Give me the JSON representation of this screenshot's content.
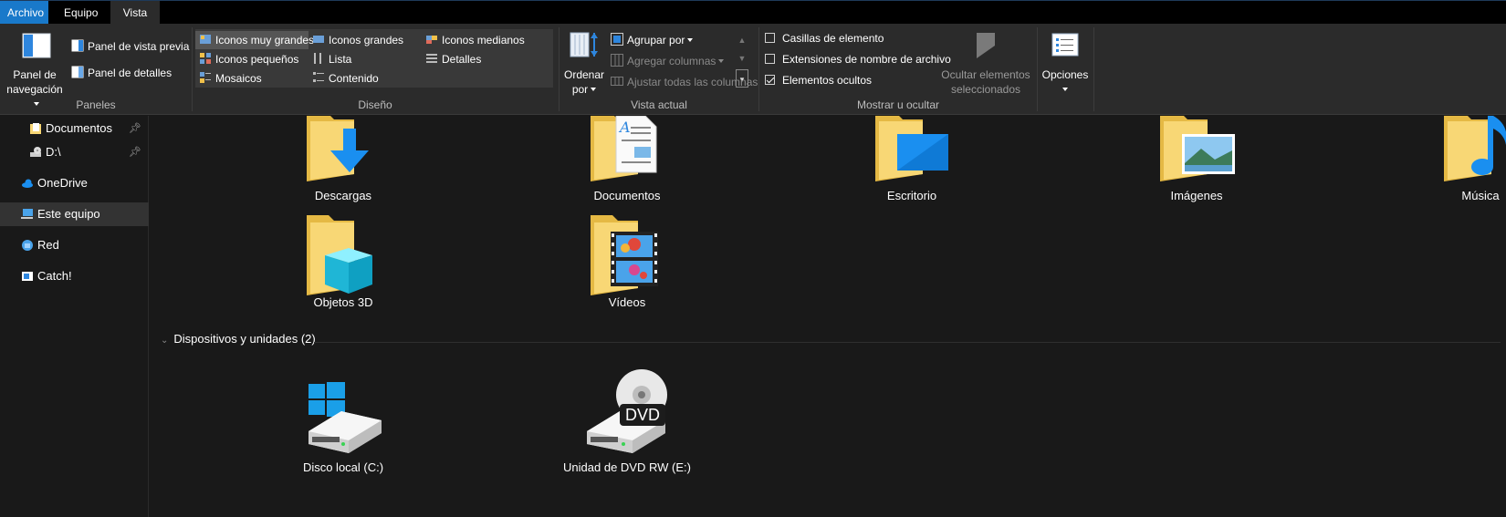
{
  "tabs": {
    "file": "Archivo",
    "computer": "Equipo",
    "view": "Vista"
  },
  "ribbon": {
    "panes": {
      "nav_pane_line1": "Panel de",
      "nav_pane_line2": "navegación",
      "preview_pane": "Panel de vista previa",
      "details_pane": "Panel de detalles",
      "group_label": "Paneles"
    },
    "layout": {
      "items": [
        "Iconos muy grandes",
        "Iconos grandes",
        "Iconos medianos",
        "Iconos pequeños",
        "Lista",
        "Detalles",
        "Mosaicos",
        "Contenido"
      ],
      "selected": "Iconos muy grandes",
      "group_label": "Diseño"
    },
    "current_view": {
      "sort_line1": "Ordenar",
      "sort_line2": "por",
      "group_by": "Agrupar por",
      "add_columns": "Agregar columnas",
      "fit_columns": "Ajustar todas las columnas",
      "group_label": "Vista actual"
    },
    "show_hide": {
      "item_checkboxes": "Casillas de elemento",
      "item_checkboxes_checked": false,
      "file_extensions": "Extensiones de nombre de archivo",
      "file_extensions_checked": false,
      "hidden_items": "Elementos ocultos",
      "hidden_items_checked": true,
      "hide_selected_line1": "Ocultar elementos",
      "hide_selected_line2": "seleccionados",
      "group_label": "Mostrar u ocultar"
    },
    "options": {
      "label": "Opciones"
    }
  },
  "sidebar": {
    "items": [
      {
        "label": "Documentos",
        "icon": "documents-folder-icon",
        "pinned": true
      },
      {
        "label": "D:\\",
        "icon": "drive-icon",
        "pinned": true
      },
      {
        "label": "OneDrive",
        "icon": "onedrive-cloud-icon",
        "pinned": false
      },
      {
        "label": "Este equipo",
        "icon": "this-pc-icon",
        "pinned": false,
        "selected": true
      },
      {
        "label": "Red",
        "icon": "network-icon",
        "pinned": false
      },
      {
        "label": "Catch!",
        "icon": "catch-app-icon",
        "pinned": false
      }
    ]
  },
  "folders": [
    {
      "label": "Descargas",
      "icon": "downloads-folder-icon"
    },
    {
      "label": "Documentos",
      "icon": "documents-folder-icon"
    },
    {
      "label": "Escritorio",
      "icon": "desktop-folder-icon"
    },
    {
      "label": "Imágenes",
      "icon": "pictures-folder-icon"
    },
    {
      "label": "Música",
      "icon": "music-folder-icon"
    },
    {
      "label": "Objetos 3D",
      "icon": "3d-objects-folder-icon"
    },
    {
      "label": "Vídeos",
      "icon": "videos-folder-icon"
    }
  ],
  "devices_section": {
    "title": "Dispositivos y unidades (2)",
    "items": [
      {
        "label": "Disco local (C:)",
        "icon": "windows-drive-icon"
      },
      {
        "label": "Unidad de DVD RW (E:)",
        "icon": "dvd-drive-icon",
        "badge": "DVD"
      }
    ]
  },
  "colors": {
    "accent": "#1979ca",
    "background": "#191919",
    "ribbon": "#2b2b2b",
    "folder": "#f8d775",
    "blue_icon": "#1a8ff0"
  }
}
